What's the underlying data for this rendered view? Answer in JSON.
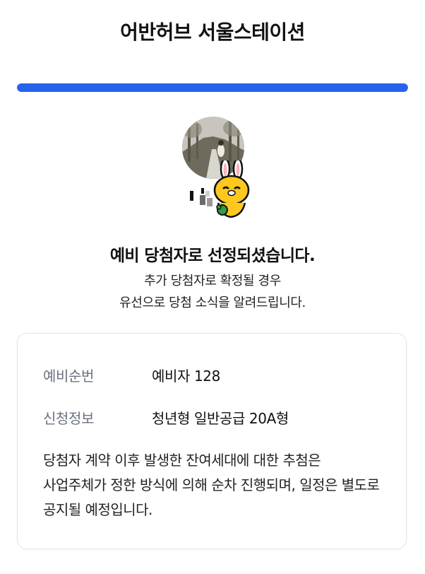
{
  "header": {
    "title": "어반허브 서울스테이션"
  },
  "progress": {
    "value_percent": 100,
    "color": "#2563eb"
  },
  "profile": {
    "avatar_icon": "profile-photo-icon",
    "sticker_icon": "character-sticker-icon"
  },
  "result": {
    "headline": "예비 당첨자로 선정되셨습니다.",
    "sub_line1": "추가 당첨자로 확정될 경우",
    "sub_line2": "유선으로 당첨 소식을 알려드립니다."
  },
  "details": {
    "rows": [
      {
        "label": "예비순번",
        "value": "예비자 128"
      },
      {
        "label": "신청정보",
        "value": "청년형 일반공급 20A형"
      }
    ],
    "notice": "당첨자 계약 이후 발생한 잔여세대에 대한 추첨은 사업주체가 정한 방식에 의해 순차 진행되며, 일정은 별도로 공지될 예정입니다."
  }
}
